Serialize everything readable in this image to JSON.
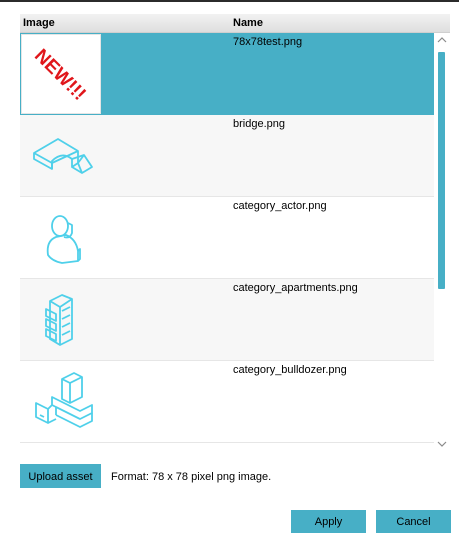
{
  "header": {
    "image_label": "Image",
    "name_label": "Name"
  },
  "assets": [
    {
      "name": "78x78test.png",
      "icon": "new-badge-icon",
      "selected": true,
      "badge_text": "NEW!!!"
    },
    {
      "name": "bridge.png",
      "icon": "bridge-icon"
    },
    {
      "name": "category_actor.png",
      "icon": "actor-icon"
    },
    {
      "name": "category_apartments.png",
      "icon": "apartments-icon"
    },
    {
      "name": "category_bulldozer.png",
      "icon": "bulldozer-icon"
    }
  ],
  "upload": {
    "label": "Upload asset",
    "format_text": "Format: 78 x 78 pixel png image."
  },
  "footer": {
    "apply_label": "Apply",
    "cancel_label": "Cancel"
  },
  "colors": {
    "accent": "#47afc6",
    "icon_stroke": "#4fd0ea",
    "badge_red": "#e0161b"
  }
}
